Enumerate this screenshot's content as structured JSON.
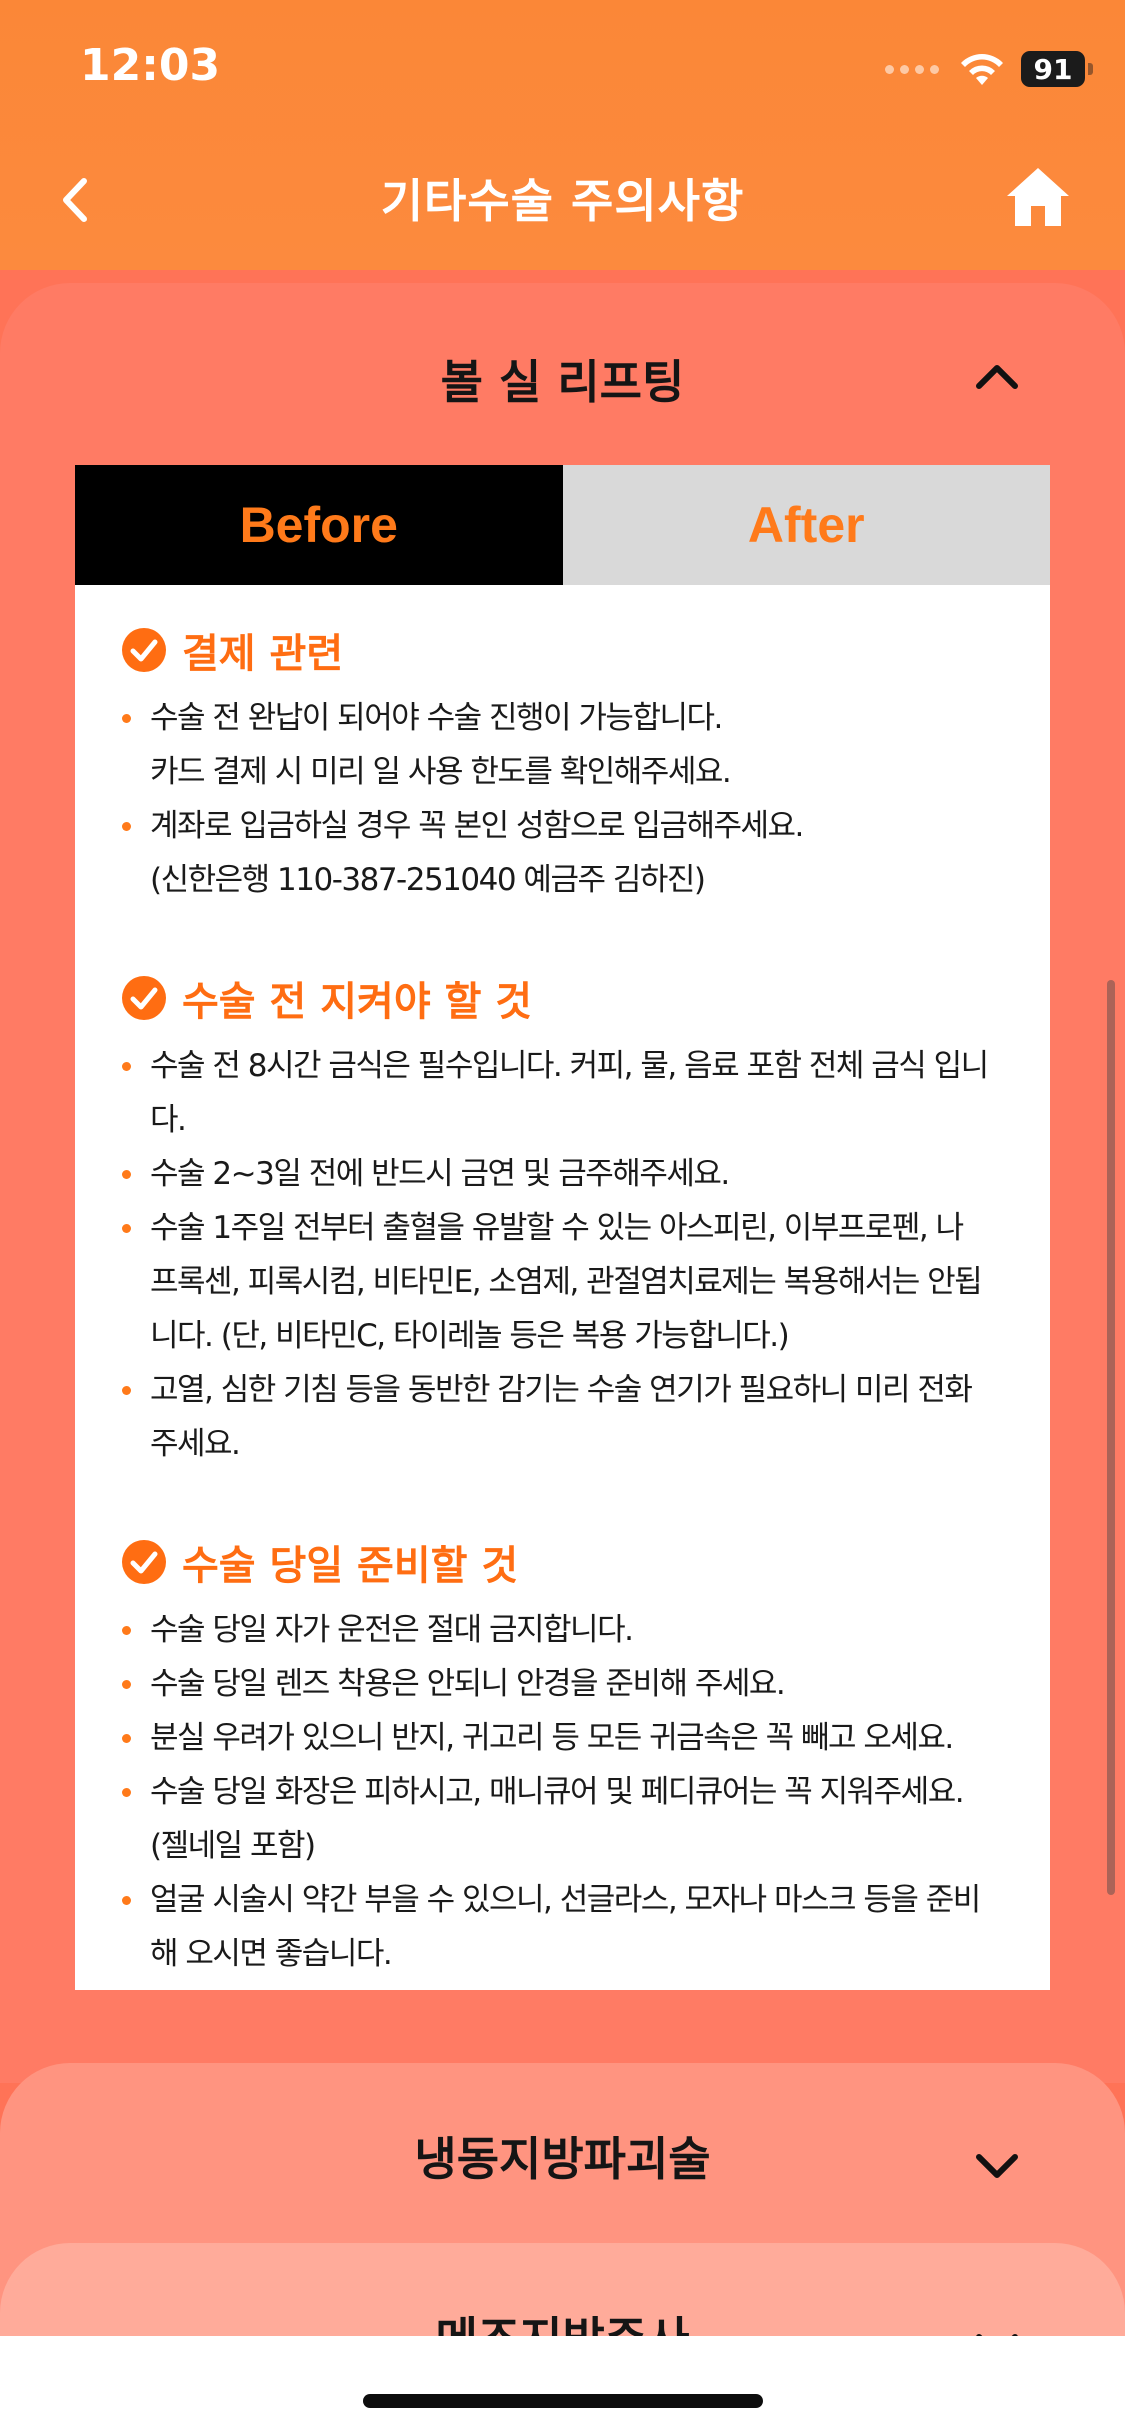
{
  "status": {
    "time": "12:03",
    "battery": "91"
  },
  "nav": {
    "title": "기타수술 주의사항"
  },
  "accordions": [
    {
      "title": "볼 실 리프팅",
      "expanded": true
    },
    {
      "title": "냉동지방파괴술",
      "expanded": false
    },
    {
      "title": "메조지방주사",
      "expanded": false
    }
  ],
  "tabs": {
    "before": "Before",
    "after": "After",
    "active": "before"
  },
  "sections": [
    {
      "title": "결제 관련",
      "bullets": [
        {
          "lines": [
            "수술 전 완납이 되어야 수술 진행이 가능합니다.",
            "카드 결제 시 미리 일 사용 한도를 확인해주세요."
          ]
        },
        {
          "lines": [
            "계좌로 입금하실 경우 꼭 본인 성함으로 입금해주세요.",
            "(신한은행 110-387-251040 예금주 김하진)"
          ]
        }
      ]
    },
    {
      "title": "수술 전 지켜야 할 것",
      "bullets": [
        {
          "lines": [
            "수술 전 8시간 금식은 필수입니다. 커피, 물, 음료 포함 전체 금식 입니",
            "다."
          ]
        },
        {
          "lines": [
            "수술 2~3일 전에 반드시 금연 및 금주해주세요."
          ]
        },
        {
          "lines": [
            "수술 1주일 전부터 출혈을 유발할 수 있는 아스피린, 이부프로펜, 나",
            "프록센, 피록시컴, 비타민E, 소염제, 관절염치료제는 복용해서는 안됩",
            "니다. (단, 비타민C, 타이레놀 등은 복용 가능합니다.)"
          ]
        },
        {
          "lines": [
            "고열, 심한 기침 등을 동반한 감기는 수술 연기가 필요하니 미리 전화",
            "주세요."
          ]
        }
      ]
    },
    {
      "title": "수술 당일 준비할 것",
      "bullets": [
        {
          "lines": [
            "수술 당일 자가 운전은 절대 금지합니다."
          ]
        },
        {
          "lines": [
            "수술 당일 렌즈 착용은 안되니 안경을 준비해 주세요."
          ]
        },
        {
          "lines": [
            "분실 우려가 있으니 반지, 귀고리 등 모든 귀금속은 꼭 빼고 오세요."
          ]
        },
        {
          "lines": [
            "수술 당일 화장은 피하시고, 매니큐어 및 페디큐어는 꼭 지워주세요.",
            "(젤네일 포함)"
          ]
        },
        {
          "lines": [
            "얼굴 시술시 약간 부을 수 있으니, 선글라스, 모자나 마스크 등을 준비",
            "해 오시면 좋습니다."
          ]
        }
      ]
    }
  ],
  "colors": {
    "header": "#fb8737",
    "accent": "#ff7a1a",
    "section_title": "#ff6d12",
    "accordion_open": "#ff7b64",
    "accordion_2": "#ff9480",
    "accordion_3": "#ffab9a"
  },
  "icons": [
    "back-chevron-icon",
    "home-icon",
    "chevron-up-icon",
    "chevron-down-icon",
    "check-circle-icon",
    "wifi-icon",
    "battery-icon"
  ]
}
